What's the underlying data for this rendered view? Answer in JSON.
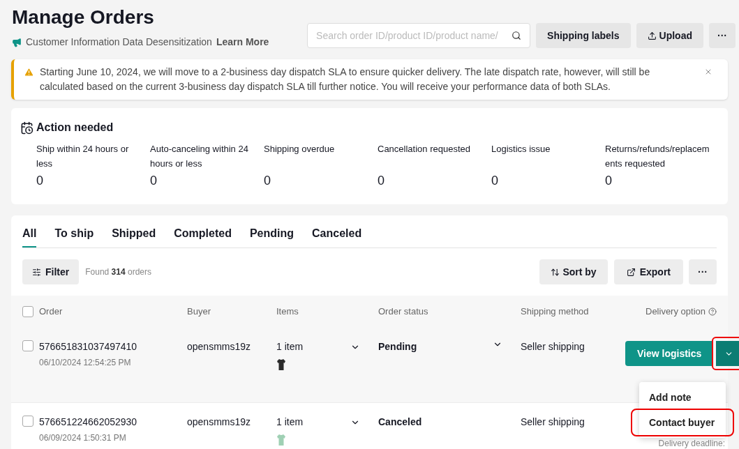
{
  "header": {
    "title": "Manage Orders",
    "notice": "Customer Information Data Desensitization",
    "notice_link": "Learn More",
    "search": {
      "placeholder": "Search order ID/product ID/product name/"
    },
    "buttons": [
      {
        "kind": "text",
        "label": "Shipping labels"
      },
      {
        "kind": "upload",
        "label": "Upload"
      },
      {
        "kind": "more",
        "label": "···"
      }
    ]
  },
  "banner": {
    "text": "Starting June 10, 2024, we will move to a 2-business day dispatch SLA to ensure quicker delivery. The late dispatch rate, however, will still be calculated based on the current 3-business day dispatch SLA till further notice. You will receive your performance data of both SLAs."
  },
  "action_needed": {
    "title": "Action needed",
    "items": [
      {
        "label": "Ship within 24 hours or less",
        "count": "0"
      },
      {
        "label": "Auto-canceling within 24 hours or less",
        "count": "0"
      },
      {
        "label": "Shipping overdue",
        "count": "0"
      },
      {
        "label": "Cancellation requested",
        "count": "0"
      },
      {
        "label": "Logistics issue",
        "count": "0"
      },
      {
        "label": "Returns/refunds/replacements requested",
        "count": "0"
      }
    ]
  },
  "tabs": [
    {
      "label": "All",
      "selected": true
    },
    {
      "label": "To ship",
      "selected": false
    },
    {
      "label": "Shipped",
      "selected": false
    },
    {
      "label": "Completed",
      "selected": false
    },
    {
      "label": "Pending",
      "selected": false
    },
    {
      "label": "Canceled",
      "selected": false
    }
  ],
  "toolbar": {
    "filter": "Filter",
    "found_prefix": "Found",
    "found_count": "314",
    "found_suffix": "orders",
    "sort": "Sort by",
    "export": "Export",
    "more": "···"
  },
  "table": {
    "select_all_checked": false,
    "columns": [
      "Order",
      "Buyer",
      "Items",
      "Order status",
      "Shipping method",
      "Delivery option"
    ],
    "rows": [
      {
        "order_id": "576651831037497410",
        "date": "06/10/2024 12:54:25 PM",
        "buyer": "opensmms19z",
        "items": "1 item",
        "color": "#2a2a2a",
        "status": "Pending",
        "status_dropdown": true,
        "shipping": "Seller shipping",
        "checked": false,
        "hovered": true,
        "action": "View logistics",
        "toggle_highlighted": true
      },
      {
        "order_id": "576651224662052930",
        "date": "06/09/2024 1:50:31 PM",
        "buyer": "opensmms19z",
        "items": "1 item",
        "color": "#9fd0b4",
        "status": "Canceled",
        "status_dropdown": false,
        "shipping": "Seller shipping",
        "checked": false,
        "hovered": false,
        "deadline": "Delivery deadline:"
      }
    ]
  },
  "menu": {
    "items": [
      {
        "label": "Add note",
        "highlighted": false
      },
      {
        "label": "Contact buyer",
        "highlighted": true
      }
    ]
  }
}
